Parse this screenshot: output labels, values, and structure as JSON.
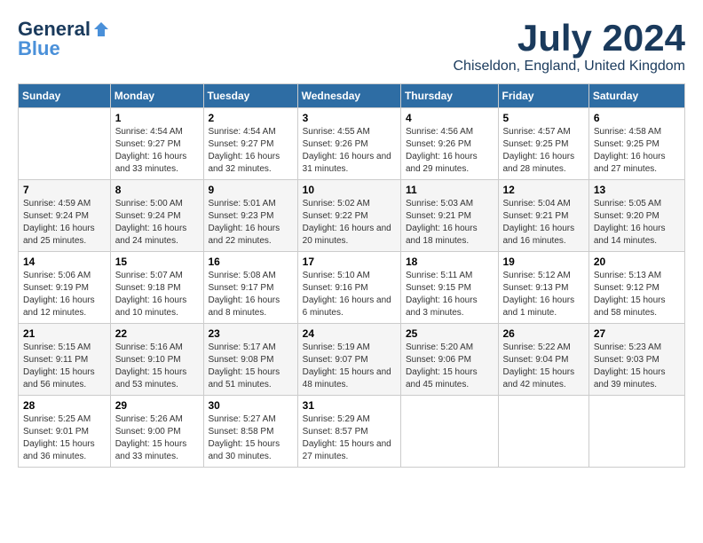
{
  "header": {
    "logo_general": "General",
    "logo_blue": "Blue",
    "month_title": "July 2024",
    "location": "Chiseldon, England, United Kingdom"
  },
  "days_of_week": [
    "Sunday",
    "Monday",
    "Tuesday",
    "Wednesday",
    "Thursday",
    "Friday",
    "Saturday"
  ],
  "weeks": [
    [
      {
        "day": "",
        "sunrise": "",
        "sunset": "",
        "daylight": ""
      },
      {
        "day": "1",
        "sunrise": "Sunrise: 4:54 AM",
        "sunset": "Sunset: 9:27 PM",
        "daylight": "Daylight: 16 hours and 33 minutes."
      },
      {
        "day": "2",
        "sunrise": "Sunrise: 4:54 AM",
        "sunset": "Sunset: 9:27 PM",
        "daylight": "Daylight: 16 hours and 32 minutes."
      },
      {
        "day": "3",
        "sunrise": "Sunrise: 4:55 AM",
        "sunset": "Sunset: 9:26 PM",
        "daylight": "Daylight: 16 hours and 31 minutes."
      },
      {
        "day": "4",
        "sunrise": "Sunrise: 4:56 AM",
        "sunset": "Sunset: 9:26 PM",
        "daylight": "Daylight: 16 hours and 29 minutes."
      },
      {
        "day": "5",
        "sunrise": "Sunrise: 4:57 AM",
        "sunset": "Sunset: 9:25 PM",
        "daylight": "Daylight: 16 hours and 28 minutes."
      },
      {
        "day": "6",
        "sunrise": "Sunrise: 4:58 AM",
        "sunset": "Sunset: 9:25 PM",
        "daylight": "Daylight: 16 hours and 27 minutes."
      }
    ],
    [
      {
        "day": "7",
        "sunrise": "Sunrise: 4:59 AM",
        "sunset": "Sunset: 9:24 PM",
        "daylight": "Daylight: 16 hours and 25 minutes."
      },
      {
        "day": "8",
        "sunrise": "Sunrise: 5:00 AM",
        "sunset": "Sunset: 9:24 PM",
        "daylight": "Daylight: 16 hours and 24 minutes."
      },
      {
        "day": "9",
        "sunrise": "Sunrise: 5:01 AM",
        "sunset": "Sunset: 9:23 PM",
        "daylight": "Daylight: 16 hours and 22 minutes."
      },
      {
        "day": "10",
        "sunrise": "Sunrise: 5:02 AM",
        "sunset": "Sunset: 9:22 PM",
        "daylight": "Daylight: 16 hours and 20 minutes."
      },
      {
        "day": "11",
        "sunrise": "Sunrise: 5:03 AM",
        "sunset": "Sunset: 9:21 PM",
        "daylight": "Daylight: 16 hours and 18 minutes."
      },
      {
        "day": "12",
        "sunrise": "Sunrise: 5:04 AM",
        "sunset": "Sunset: 9:21 PM",
        "daylight": "Daylight: 16 hours and 16 minutes."
      },
      {
        "day": "13",
        "sunrise": "Sunrise: 5:05 AM",
        "sunset": "Sunset: 9:20 PM",
        "daylight": "Daylight: 16 hours and 14 minutes."
      }
    ],
    [
      {
        "day": "14",
        "sunrise": "Sunrise: 5:06 AM",
        "sunset": "Sunset: 9:19 PM",
        "daylight": "Daylight: 16 hours and 12 minutes."
      },
      {
        "day": "15",
        "sunrise": "Sunrise: 5:07 AM",
        "sunset": "Sunset: 9:18 PM",
        "daylight": "Daylight: 16 hours and 10 minutes."
      },
      {
        "day": "16",
        "sunrise": "Sunrise: 5:08 AM",
        "sunset": "Sunset: 9:17 PM",
        "daylight": "Daylight: 16 hours and 8 minutes."
      },
      {
        "day": "17",
        "sunrise": "Sunrise: 5:10 AM",
        "sunset": "Sunset: 9:16 PM",
        "daylight": "Daylight: 16 hours and 6 minutes."
      },
      {
        "day": "18",
        "sunrise": "Sunrise: 5:11 AM",
        "sunset": "Sunset: 9:15 PM",
        "daylight": "Daylight: 16 hours and 3 minutes."
      },
      {
        "day": "19",
        "sunrise": "Sunrise: 5:12 AM",
        "sunset": "Sunset: 9:13 PM",
        "daylight": "Daylight: 16 hours and 1 minute."
      },
      {
        "day": "20",
        "sunrise": "Sunrise: 5:13 AM",
        "sunset": "Sunset: 9:12 PM",
        "daylight": "Daylight: 15 hours and 58 minutes."
      }
    ],
    [
      {
        "day": "21",
        "sunrise": "Sunrise: 5:15 AM",
        "sunset": "Sunset: 9:11 PM",
        "daylight": "Daylight: 15 hours and 56 minutes."
      },
      {
        "day": "22",
        "sunrise": "Sunrise: 5:16 AM",
        "sunset": "Sunset: 9:10 PM",
        "daylight": "Daylight: 15 hours and 53 minutes."
      },
      {
        "day": "23",
        "sunrise": "Sunrise: 5:17 AM",
        "sunset": "Sunset: 9:08 PM",
        "daylight": "Daylight: 15 hours and 51 minutes."
      },
      {
        "day": "24",
        "sunrise": "Sunrise: 5:19 AM",
        "sunset": "Sunset: 9:07 PM",
        "daylight": "Daylight: 15 hours and 48 minutes."
      },
      {
        "day": "25",
        "sunrise": "Sunrise: 5:20 AM",
        "sunset": "Sunset: 9:06 PM",
        "daylight": "Daylight: 15 hours and 45 minutes."
      },
      {
        "day": "26",
        "sunrise": "Sunrise: 5:22 AM",
        "sunset": "Sunset: 9:04 PM",
        "daylight": "Daylight: 15 hours and 42 minutes."
      },
      {
        "day": "27",
        "sunrise": "Sunrise: 5:23 AM",
        "sunset": "Sunset: 9:03 PM",
        "daylight": "Daylight: 15 hours and 39 minutes."
      }
    ],
    [
      {
        "day": "28",
        "sunrise": "Sunrise: 5:25 AM",
        "sunset": "Sunset: 9:01 PM",
        "daylight": "Daylight: 15 hours and 36 minutes."
      },
      {
        "day": "29",
        "sunrise": "Sunrise: 5:26 AM",
        "sunset": "Sunset: 9:00 PM",
        "daylight": "Daylight: 15 hours and 33 minutes."
      },
      {
        "day": "30",
        "sunrise": "Sunrise: 5:27 AM",
        "sunset": "Sunset: 8:58 PM",
        "daylight": "Daylight: 15 hours and 30 minutes."
      },
      {
        "day": "31",
        "sunrise": "Sunrise: 5:29 AM",
        "sunset": "Sunset: 8:57 PM",
        "daylight": "Daylight: 15 hours and 27 minutes."
      },
      {
        "day": "",
        "sunrise": "",
        "sunset": "",
        "daylight": ""
      },
      {
        "day": "",
        "sunrise": "",
        "sunset": "",
        "daylight": ""
      },
      {
        "day": "",
        "sunrise": "",
        "sunset": "",
        "daylight": ""
      }
    ]
  ]
}
